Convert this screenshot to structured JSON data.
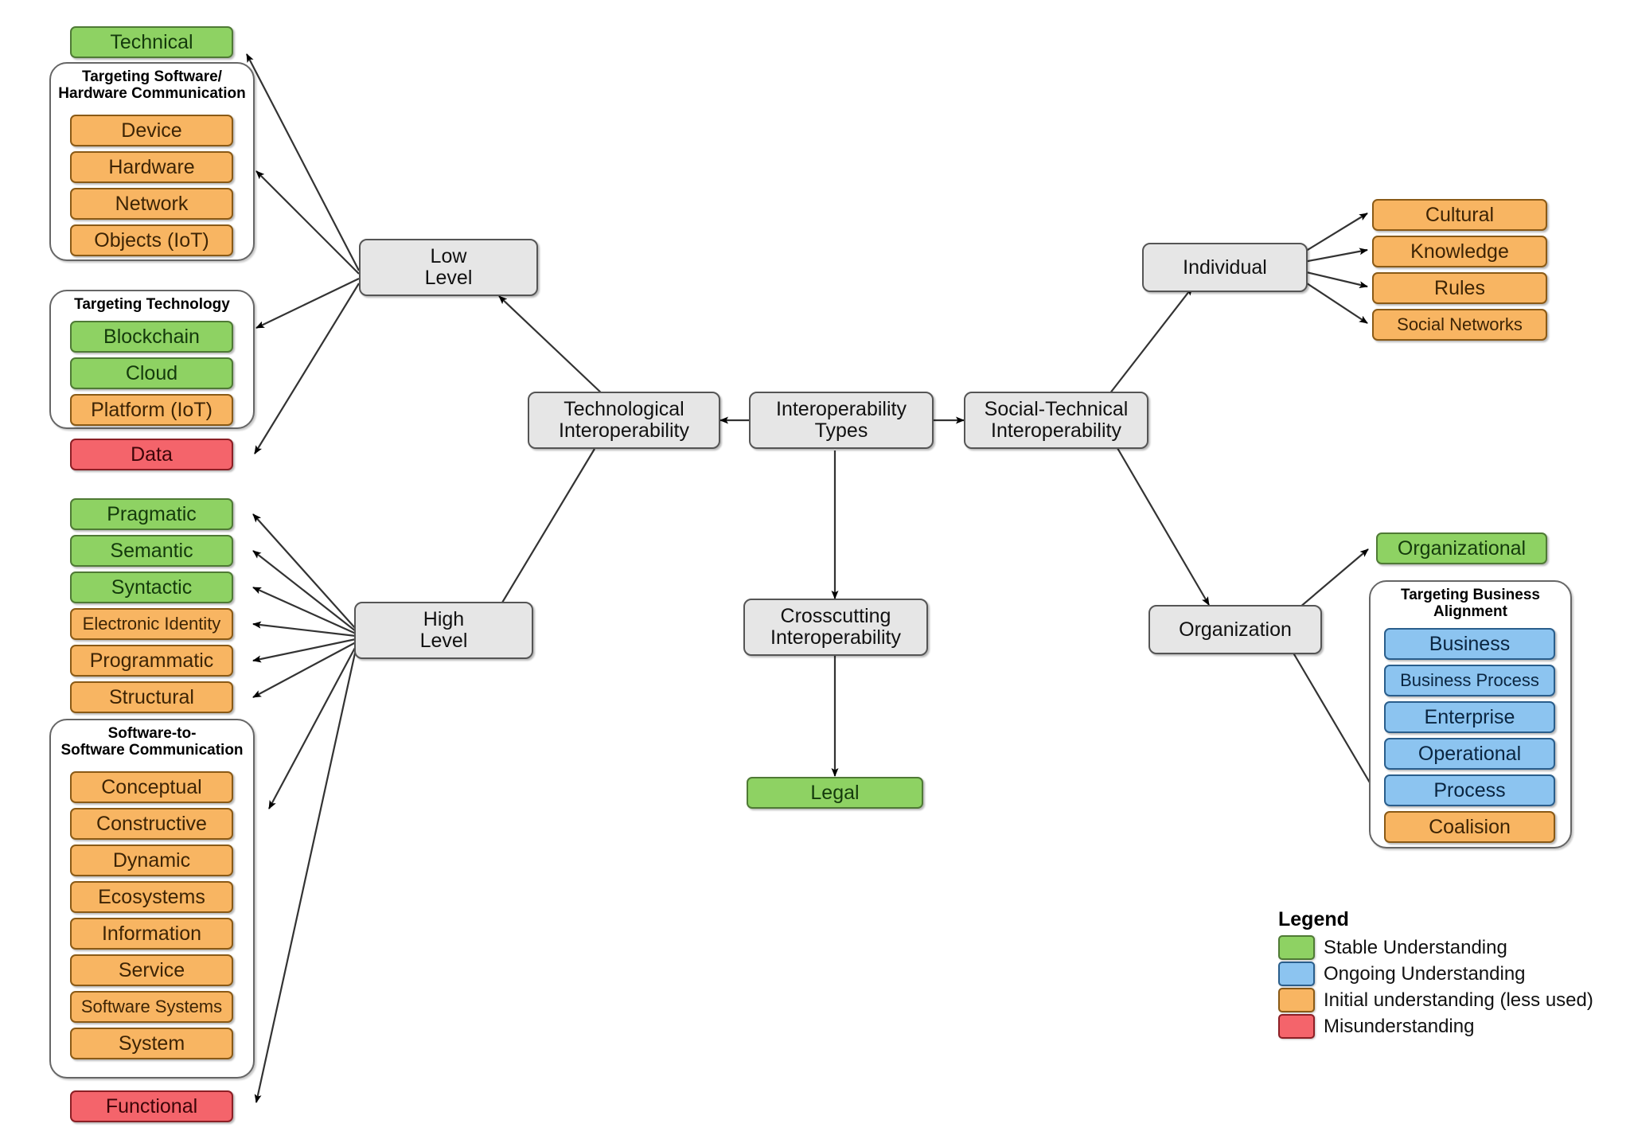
{
  "diagram": {
    "title": "Interoperability Types",
    "colors": {
      "stable_green": "#8ed263",
      "ongoing_blue": "#8cc4f0",
      "initial_orange": "#f8b562",
      "misunderstanding_red": "#f4646b",
      "process_gray": "#e6e6e6"
    }
  },
  "process_nodes": {
    "interoperability_types": "Interoperability\nTypes",
    "technological": "Technological\nInteroperability",
    "social_technical": "Social-Technical\nInteroperability",
    "crosscutting": "Crosscutting\nInteroperability",
    "low_level": "Low\nLevel",
    "high_level": "High\nLevel",
    "individual": "Individual",
    "organization": "Organization"
  },
  "groups": {
    "targeting_sw_hw": {
      "title": "Targeting Software/\nHardware Communication",
      "items": [
        {
          "label": "Device",
          "color": "orange"
        },
        {
          "label": "Hardware",
          "color": "orange"
        },
        {
          "label": "Network",
          "color": "orange"
        },
        {
          "label": "Objects (IoT)",
          "color": "orange"
        }
      ]
    },
    "targeting_technology": {
      "title": "Targeting Technology",
      "items": [
        {
          "label": "Blockchain",
          "color": "green"
        },
        {
          "label": "Cloud",
          "color": "green"
        },
        {
          "label": "Platform (IoT)",
          "color": "orange"
        }
      ]
    },
    "software_to_software": {
      "title": "Software-to-\nSoftware Communication",
      "items": [
        {
          "label": "Conceptual",
          "color": "orange"
        },
        {
          "label": "Constructive",
          "color": "orange"
        },
        {
          "label": "Dynamic",
          "color": "orange"
        },
        {
          "label": "Ecosystems",
          "color": "orange"
        },
        {
          "label": "Information",
          "color": "orange"
        },
        {
          "label": "Service",
          "color": "orange"
        },
        {
          "label": "Software Systems",
          "color": "orange"
        },
        {
          "label": "System",
          "color": "orange"
        }
      ]
    },
    "targeting_business_alignment": {
      "title": "Targeting Business\nAlignment",
      "items": [
        {
          "label": "Business",
          "color": "blue"
        },
        {
          "label": "Business Process",
          "color": "blue"
        },
        {
          "label": "Enterprise",
          "color": "blue"
        },
        {
          "label": "Operational",
          "color": "blue"
        },
        {
          "label": "Process",
          "color": "blue"
        },
        {
          "label": "Coalision",
          "color": "orange"
        }
      ]
    }
  },
  "standalone_leaves": {
    "technical": {
      "label": "Technical",
      "color": "green"
    },
    "data": {
      "label": "Data",
      "color": "red"
    },
    "functional": {
      "label": "Functional",
      "color": "red"
    },
    "legal": {
      "label": "Legal",
      "color": "green"
    },
    "organizational": {
      "label": "Organizational",
      "color": "green"
    }
  },
  "high_level_leaves": [
    {
      "label": "Pragmatic",
      "color": "green"
    },
    {
      "label": "Semantic",
      "color": "green"
    },
    {
      "label": "Syntactic",
      "color": "green"
    },
    {
      "label": "Electronic Identity",
      "color": "orange"
    },
    {
      "label": "Programmatic",
      "color": "orange"
    },
    {
      "label": "Structural",
      "color": "orange"
    }
  ],
  "individual_leaves": [
    {
      "label": "Cultural",
      "color": "orange"
    },
    {
      "label": "Knowledge",
      "color": "orange"
    },
    {
      "label": "Rules",
      "color": "orange"
    },
    {
      "label": "Social Networks",
      "color": "orange"
    }
  ],
  "legend": {
    "title": "Legend",
    "entries": [
      {
        "label": "Stable Understanding",
        "color": "#8ed263"
      },
      {
        "label": "Ongoing Understanding",
        "color": "#8cc4f0"
      },
      {
        "label": "Initial understanding (less used)",
        "color": "#8cc4f0"
      },
      {
        "label": "Misunderstanding",
        "color": "#f4646b"
      }
    ]
  }
}
